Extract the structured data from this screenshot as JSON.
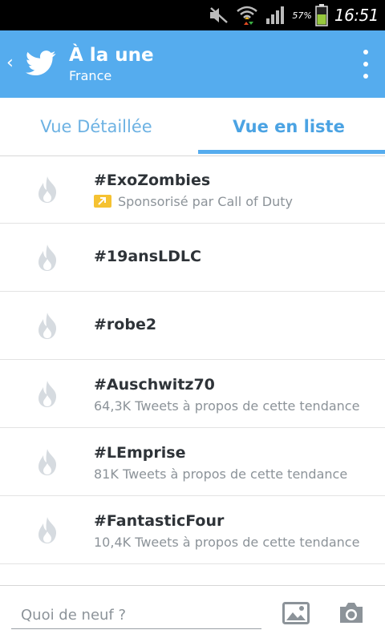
{
  "status_bar": {
    "battery_percent": "57%",
    "time": "16:51"
  },
  "header": {
    "title": "À la une",
    "subtitle": "France"
  },
  "tabs": [
    {
      "label": "Vue Détaillée",
      "selected": false
    },
    {
      "label": "Vue en liste",
      "selected": true
    }
  ],
  "trends": [
    {
      "name": "#ExoZombies",
      "promoted": true,
      "meta": "Sponsorisé par Call of Duty"
    },
    {
      "name": "#19ansLDLC",
      "meta": ""
    },
    {
      "name": "#robe2",
      "meta": ""
    },
    {
      "name": "#Auschwitz70",
      "meta": "64,3K Tweets à propos de cette tendance"
    },
    {
      "name": "#LEmprise",
      "meta": "81K Tweets à propos de cette tendance"
    },
    {
      "name": "#FantasticFour",
      "meta": "10,4K Tweets à propos de cette tendance"
    }
  ],
  "composer": {
    "placeholder": "Quoi de neuf ?"
  },
  "colors": {
    "accent": "#55acee",
    "promo": "#f5c232"
  },
  "icons": [
    "mute-icon",
    "wifi-icon",
    "signal-icon",
    "battery-icon",
    "back-chevron-icon",
    "twitter-bird-icon",
    "overflow-menu-icon",
    "flame-icon",
    "promoted-icon",
    "photo-icon",
    "camera-icon"
  ]
}
